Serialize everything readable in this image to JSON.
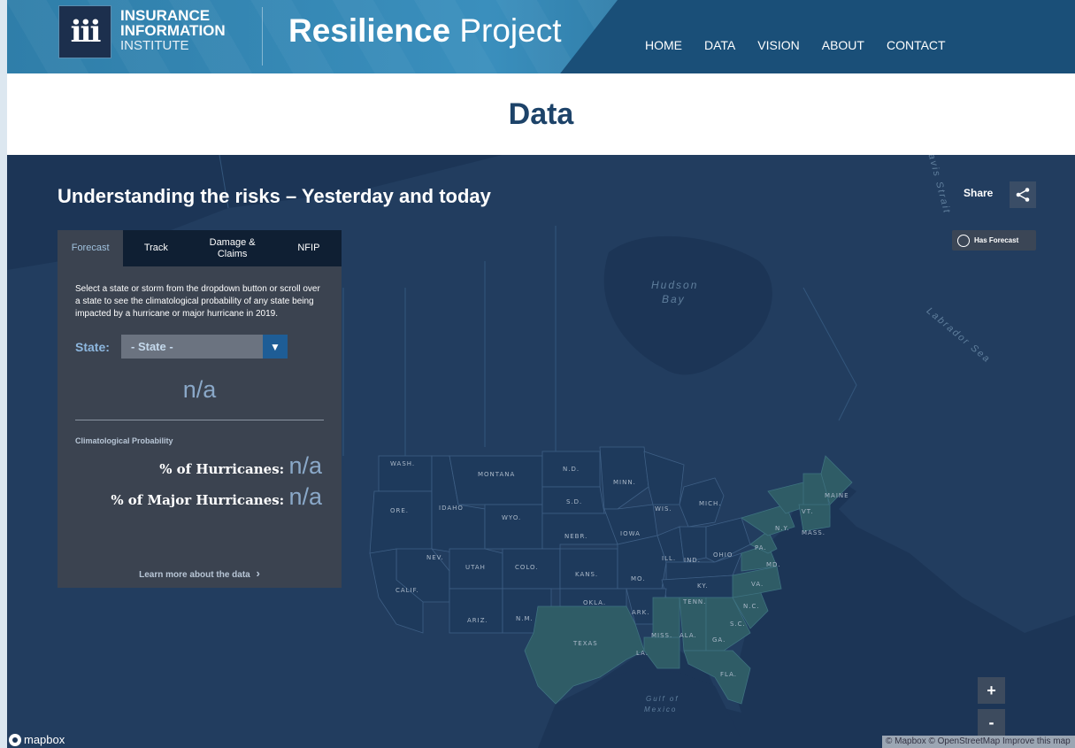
{
  "header": {
    "logo_glyph": "iii",
    "org_line1": "INSURANCE",
    "org_line2": "INFORMATION",
    "org_line3": "INSTITUTE",
    "brand_bold": "Resilience",
    "brand_light": "Project",
    "nav": [
      "HOME",
      "DATA",
      "VISION",
      "ABOUT",
      "CONTACT"
    ]
  },
  "page_title": "Data",
  "map": {
    "heading": "Understanding the risks – Yesterday and today",
    "share_label": "Share",
    "has_forecast_label": "Has Forecast",
    "water_labels": {
      "hudson1": "Hudson",
      "hudson2": "Bay",
      "gulf1": "Gulf of",
      "gulf2": "Mexico",
      "labrador": "Labrador Sea",
      "davis": "Davis Strait"
    },
    "zoom_in": "+",
    "zoom_out": "-",
    "mapbox_label": "mapbox",
    "attribution": "© Mapbox © OpenStreetMap  Improve this map",
    "highlight_color": "#2f5c66",
    "state_labels": {
      "wash": "WASH.",
      "ore": "ORE.",
      "idaho": "IDAHO",
      "montana": "MONTANA",
      "wyo": "WYO.",
      "nd": "N.D.",
      "sd": "S.D.",
      "nebr": "NEBR.",
      "minn": "MINN.",
      "iowa": "IOWA",
      "wis": "WIS.",
      "mich": "MICH.",
      "nev": "NEV.",
      "utah": "UTAH",
      "colo": "COLO.",
      "kans": "KANS.",
      "mo": "MO.",
      "ill": "ILL.",
      "ind": "IND.",
      "ohio": "OHIO",
      "pa": "PA.",
      "ny": "N.Y.",
      "vt": "VT.",
      "maine": "MAINE",
      "mass": "MASS.",
      "md": "MD.",
      "va": "VA.",
      "ky": "KY.",
      "tenn": "TENN.",
      "nc": "N.C.",
      "sc": "S.C.",
      "calif": "CALIF.",
      "ariz": "ARIZ.",
      "nm": "N.M.",
      "okla": "OKLA.",
      "ark": "ARK.",
      "texas": "TEXAS",
      "la": "LA.",
      "miss": "MISS.",
      "ala": "ALA.",
      "ga": "GA.",
      "fla": "FLA."
    }
  },
  "panel": {
    "tabs": [
      {
        "label": "Forecast",
        "active": true
      },
      {
        "label": "Track",
        "active": false
      },
      {
        "label": "Damage & Claims",
        "active": false
      },
      {
        "label": "NFIP",
        "active": false
      }
    ],
    "description": "Select a state or storm from the dropdown button or scroll over a state to see the climatological probability of any state being impacted by a hurricane or major hurricane in 2019.",
    "state_label": "State:",
    "state_selected": "- State -",
    "dropdown_arrow": "▼",
    "value_big": "n/a",
    "climatological_label": "Climatological Probability",
    "pct_hurricanes_label": "% of Hurricanes:",
    "pct_hurricanes_value": "n/a",
    "pct_major_label": "% of Major Hurricanes:",
    "pct_major_value": "n/a",
    "learn_more": "Learn more about the data",
    "learn_chevron": "›"
  }
}
